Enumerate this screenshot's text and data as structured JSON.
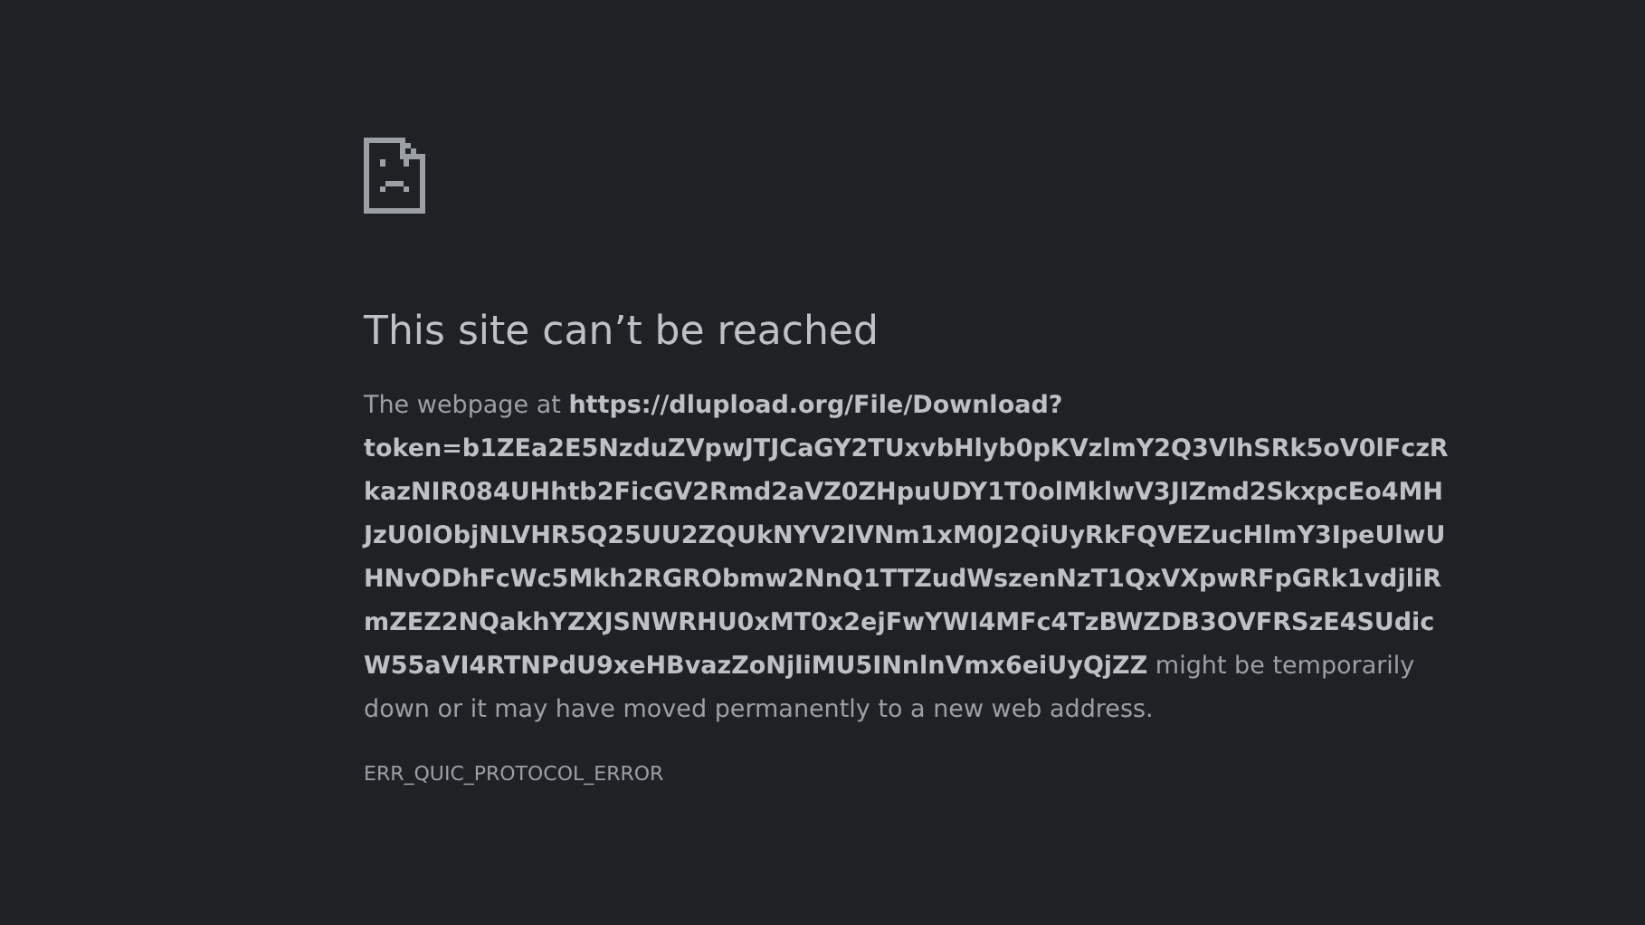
{
  "title": "This site can’t be reached",
  "message": "The webpage at **https://dlupload.org/File/Download?token=b1ZEa2E5NzduZVpwJTJCaGY2TUxvbHlyb0pKVzlmY2Q3VlhSRk5oV0lFczRkazNIR084UHhtb2FicGV2Rmd2aVZ0ZHpuUDY1T0olMklwV3JIZmd2SkxpcEo4MHJzU0lObjNLVHR5Q25UU2ZQUkNYV2lVNm1xM0J2QiUyRkFQVEZucHlmY3IpeUlwUHNvODhFcWc5Mkh2RGRObmw2NnQ1TTZudWszenNzT1QxVXpwRFpGRk1vdjliRmZEZ2NQakhYZXJSNWRHU0xMT0x2ejFwYWI4MFc4TzBWZDB3OVFRSzE4SUdicW55aVI4RTNPdU9xeHBvazZoNjliMU5INnlnVmx6eiUyQjZZ** might be temporarily down or it may have moved permanently to a new web address.",
  "error_code": "ERR_QUIC_PROTOCOL_ERROR"
}
